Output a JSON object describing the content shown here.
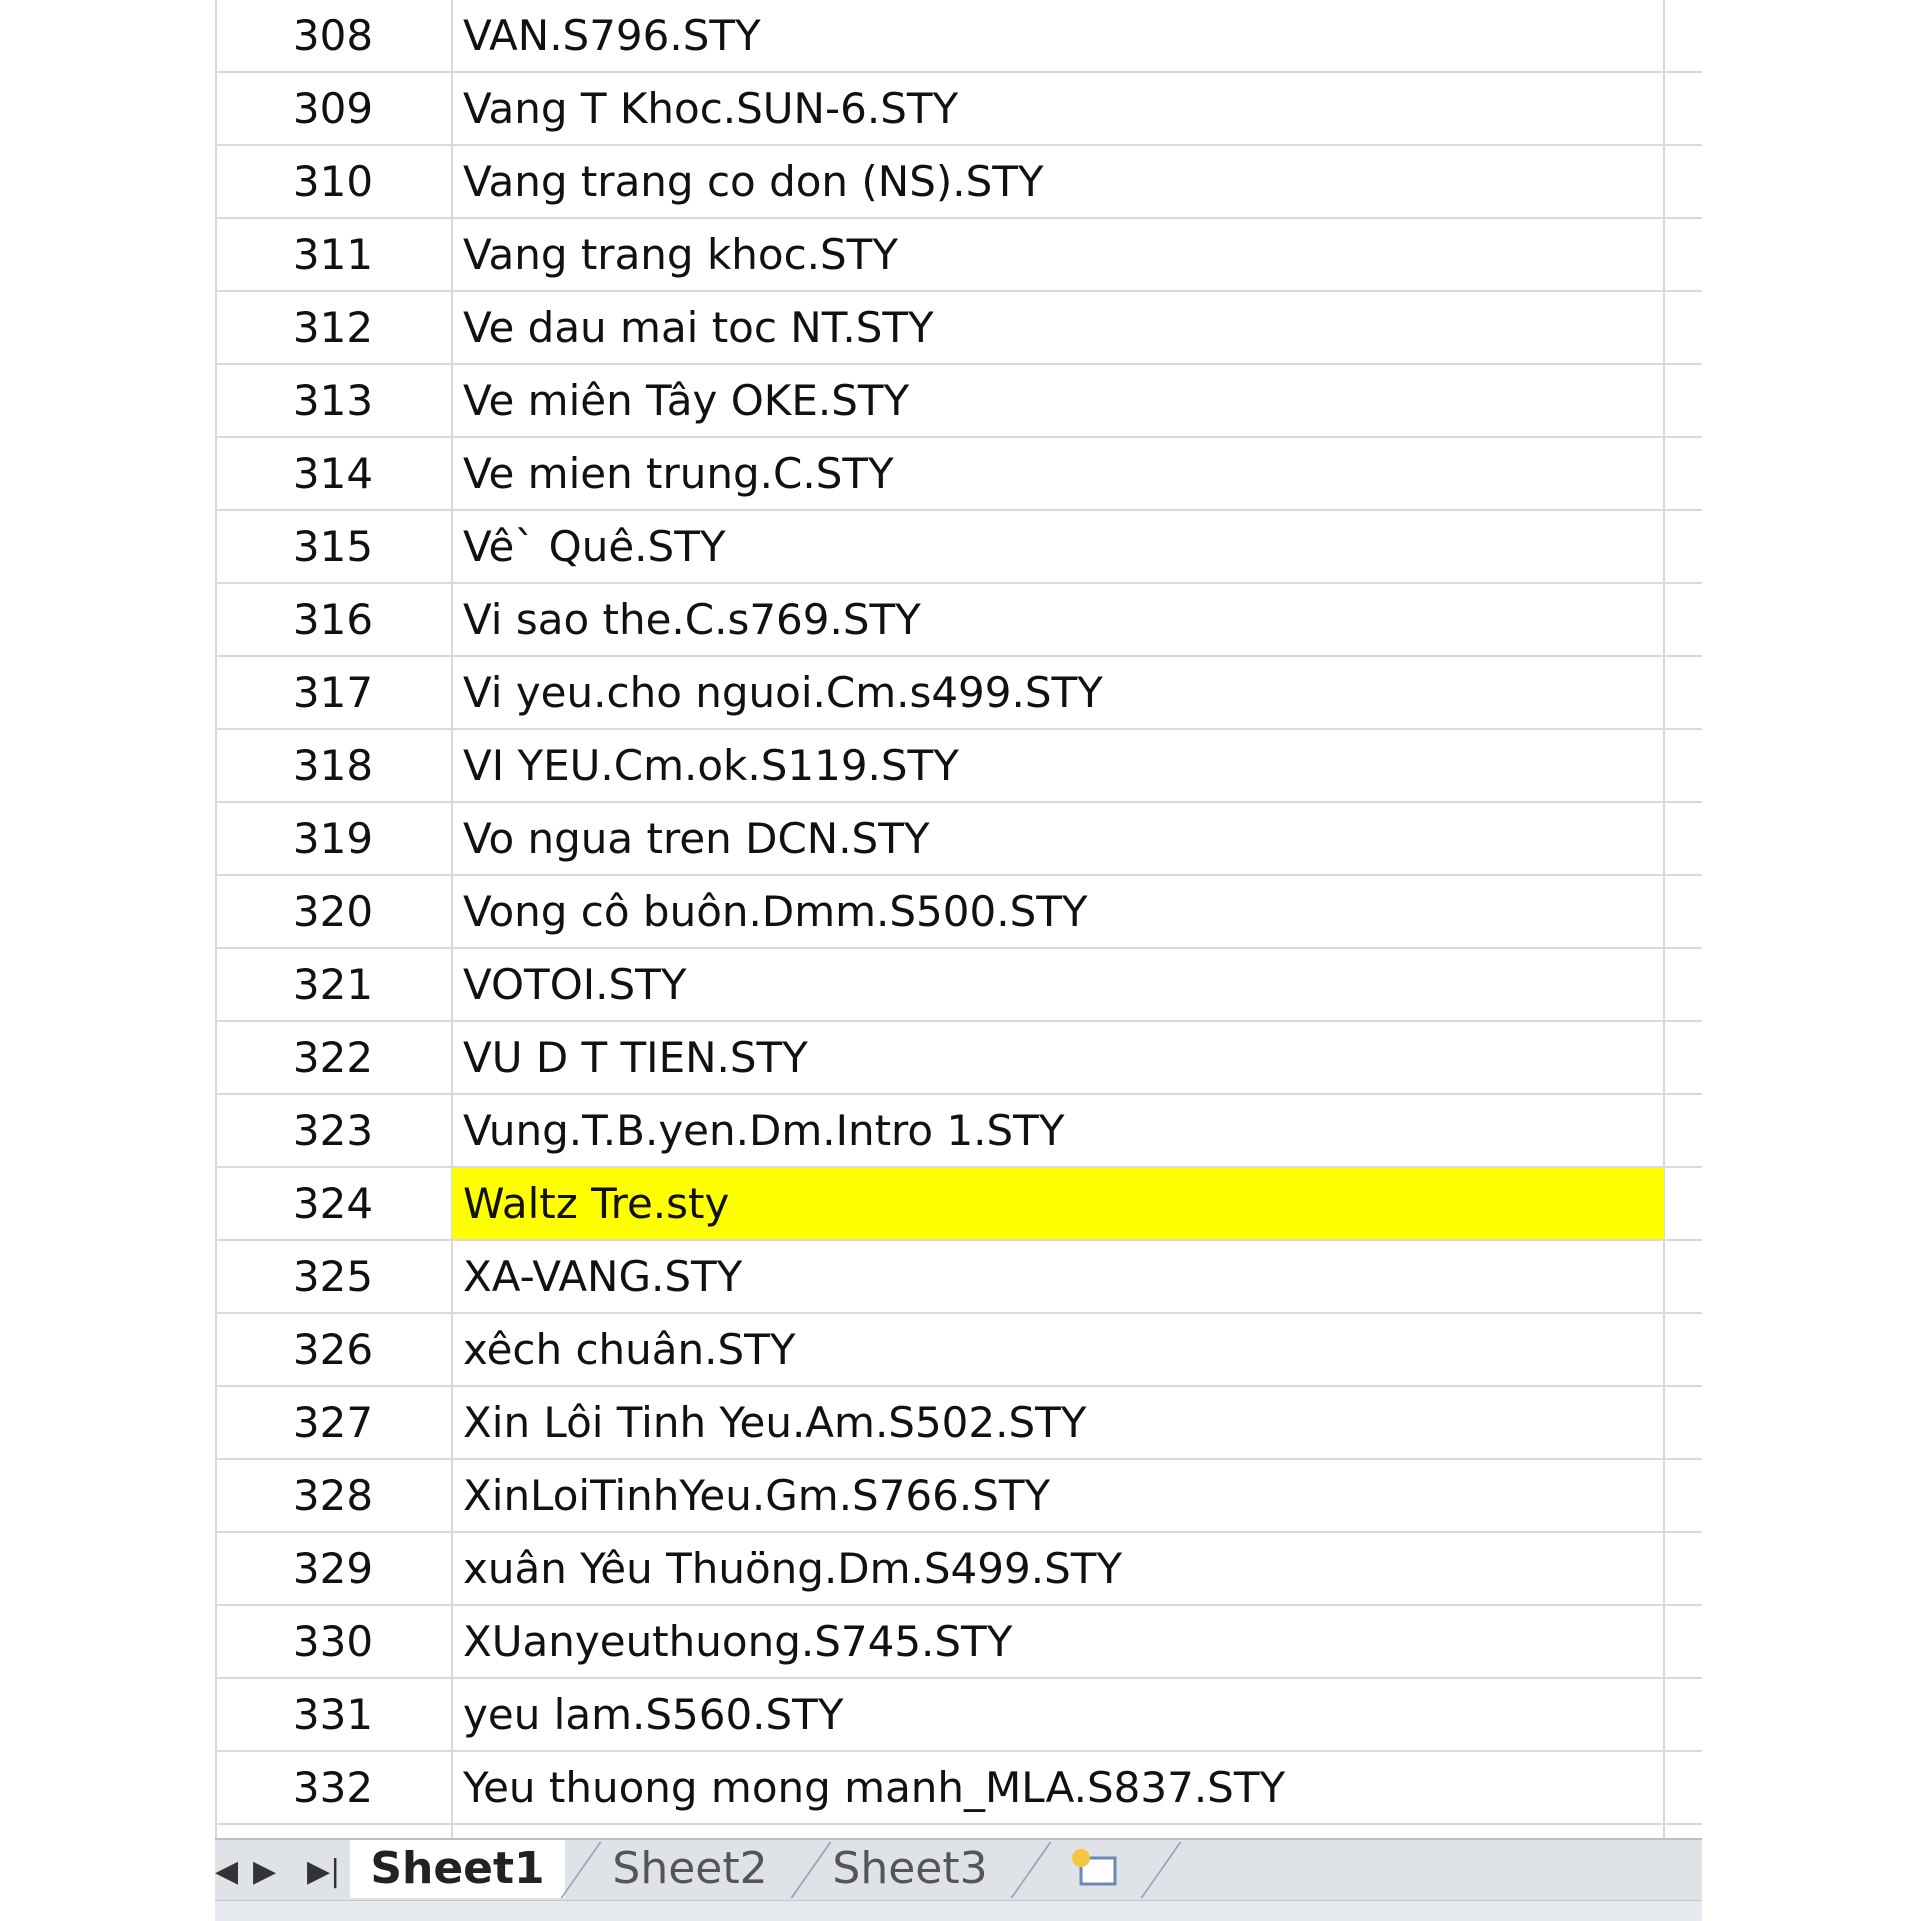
{
  "rows": [
    {
      "num": "308",
      "name": "VAN.S796.STY"
    },
    {
      "num": "309",
      "name": "Vang T Khoc.SUN-6.STY"
    },
    {
      "num": "310",
      "name": "Vang trang co don (NS).STY"
    },
    {
      "num": "311",
      "name": "Vang trang khoc.STY"
    },
    {
      "num": "312",
      "name": "Ve dau mai toc NT.STY"
    },
    {
      "num": "313",
      "name": "Ve miên Tây OKE.STY"
    },
    {
      "num": "314",
      "name": "Ve mien trung.C.STY"
    },
    {
      "num": "315",
      "name": "Vê` Quê.STY"
    },
    {
      "num": "316",
      "name": "Vi sao the.C.s769.STY"
    },
    {
      "num": "317",
      "name": "Vi yeu.cho nguoi.Cm.s499.STY"
    },
    {
      "num": "318",
      "name": "VI YEU.Cm.ok.S119.STY"
    },
    {
      "num": "319",
      "name": "Vo ngua tren DCN.STY"
    },
    {
      "num": "320",
      "name": "Vong cô buôn.Dmm.S500.STY"
    },
    {
      "num": "321",
      "name": "VOTOI.STY"
    },
    {
      "num": "322",
      "name": "VU D T TIEN.STY"
    },
    {
      "num": "323",
      "name": "Vung.T.B.yen.Dm.Intro 1.STY"
    },
    {
      "num": "324",
      "name": "Waltz Tre.sty",
      "highlight": true
    },
    {
      "num": "325",
      "name": "XA-VANG.STY"
    },
    {
      "num": "326",
      "name": "xêch chuân.STY"
    },
    {
      "num": "327",
      "name": "Xin Lôi Tinh Yeu.Am.S502.STY"
    },
    {
      "num": "328",
      "name": "XinLoiTinhYeu.Gm.S766.STY"
    },
    {
      "num": "329",
      "name": "xuân Yêu Thuöng.Dm.S499.STY"
    },
    {
      "num": "330",
      "name": "XUanyeuthuong.S745.STY"
    },
    {
      "num": "331",
      "name": "yeu lam.S560.STY"
    },
    {
      "num": "332",
      "name": "Yeu thuong mong manh_MLA.S837.STY"
    }
  ],
  "highlight_color": "#ffff00",
  "sheet_tabs": [
    {
      "label": "Sheet1",
      "active": true
    },
    {
      "label": "Sheet2",
      "active": false
    },
    {
      "label": "Sheet3",
      "active": false
    }
  ],
  "nav_icons": [
    "scroll-next-sheet-icon",
    "scroll-last-sheet-icon"
  ],
  "insert_sheet_icon": "insert-worksheet-icon"
}
